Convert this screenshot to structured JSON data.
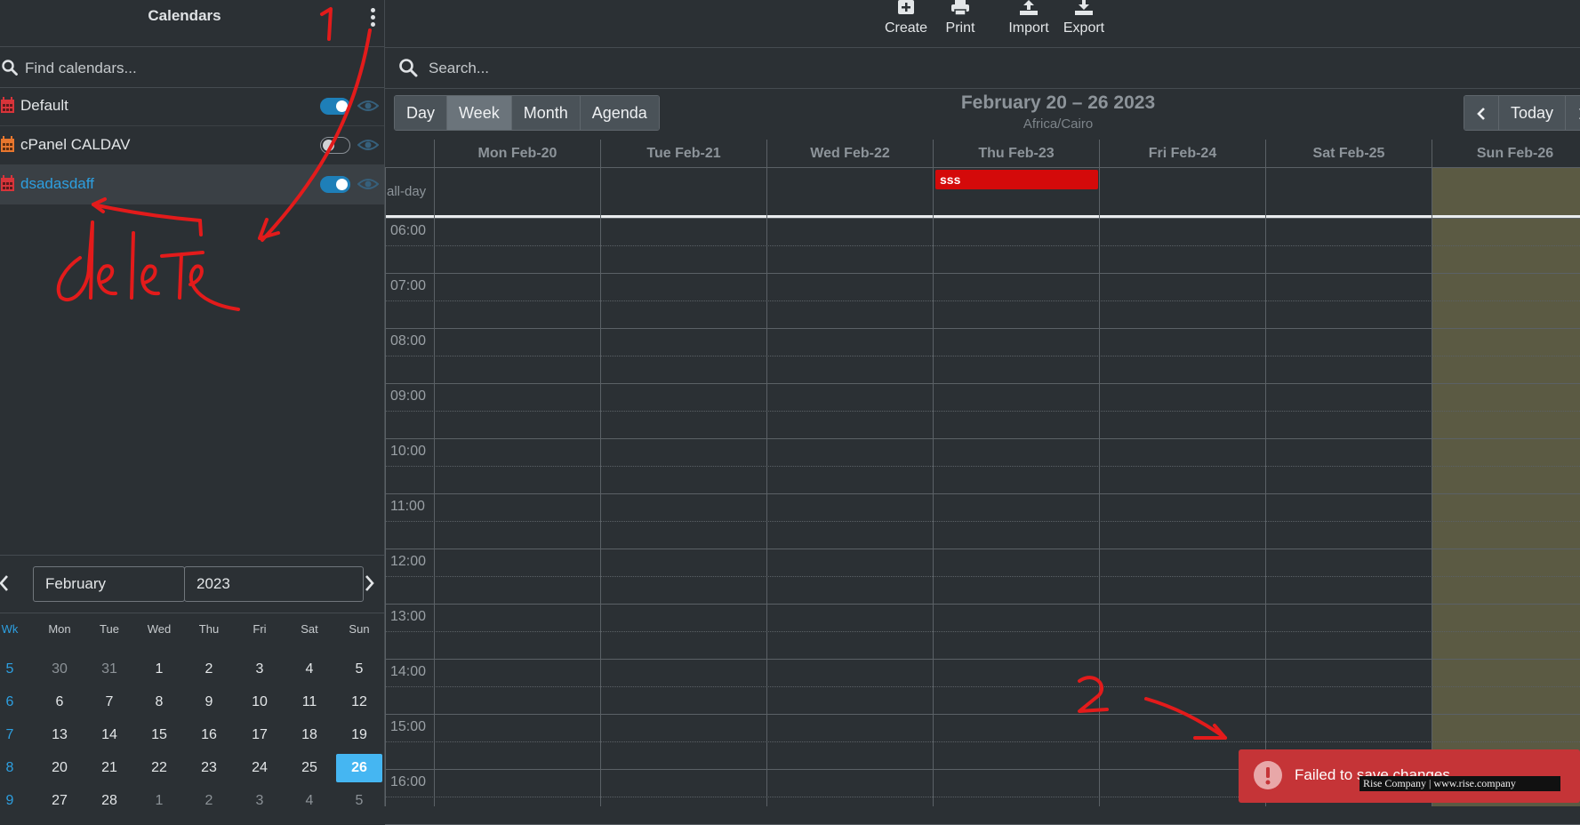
{
  "sidebar": {
    "title": "Calendars",
    "search_placeholder": "Find calendars...",
    "calendars": [
      {
        "name": "Default",
        "enabled": true,
        "icon": "calendar-icon",
        "color": "#d8343a"
      },
      {
        "name": "cPanel CALDAV",
        "enabled": false,
        "icon": "calendar-icon",
        "color": "#e8772e"
      },
      {
        "name": "dsadasdaff",
        "enabled": true,
        "icon": "calendar-icon",
        "color": "#d8343a",
        "selected": true
      }
    ]
  },
  "mini_calendar": {
    "month": "February",
    "year": "2023",
    "headers": [
      "Wk",
      "Mon",
      "Tue",
      "Wed",
      "Thu",
      "Fri",
      "Sat",
      "Sun"
    ],
    "weeks": [
      {
        "wk": "5",
        "days": [
          "30",
          "31",
          "1",
          "2",
          "3",
          "4",
          "5"
        ]
      },
      {
        "wk": "6",
        "days": [
          "6",
          "7",
          "8",
          "9",
          "10",
          "11",
          "12"
        ]
      },
      {
        "wk": "7",
        "days": [
          "13",
          "14",
          "15",
          "16",
          "17",
          "18",
          "19"
        ]
      },
      {
        "wk": "8",
        "days": [
          "20",
          "21",
          "22",
          "23",
          "24",
          "25",
          "26"
        ]
      },
      {
        "wk": "9",
        "days": [
          "27",
          "28",
          "1",
          "2",
          "3",
          "4",
          "5"
        ]
      }
    ],
    "today": "26"
  },
  "toolbar": {
    "create_label": "Create",
    "print_label": "Print",
    "import_label": "Import",
    "export_label": "Export"
  },
  "search": {
    "placeholder": "Search..."
  },
  "views": {
    "day": "Day",
    "week": "Week",
    "month": "Month",
    "agenda": "Agenda",
    "active": "week"
  },
  "navigation": {
    "today_label": "Today"
  },
  "range": {
    "title": "February 20 – 26 2023",
    "timezone": "Africa/Cairo"
  },
  "week": {
    "days": [
      "Mon Feb-20",
      "Tue Feb-21",
      "Wed Feb-22",
      "Thu Feb-23",
      "Fri Feb-24",
      "Sat Feb-25",
      "Sun Feb-26"
    ],
    "allday_label": "all-day",
    "times": [
      "06:00",
      "07:00",
      "08:00",
      "09:00",
      "10:00",
      "11:00",
      "12:00",
      "13:00",
      "14:00",
      "15:00",
      "16:00"
    ],
    "events": [
      {
        "title": "sss",
        "day": "Thu Feb-23",
        "allday": true,
        "color": "#d40a0a"
      }
    ],
    "today_highlight_color": "#5b5a43"
  },
  "toast": {
    "message": "Failed to save changes",
    "type": "error"
  },
  "watermark": "Rise Company | www.rise.company",
  "annotations": {
    "label_1": "1",
    "label_delete": "delete",
    "label_2": "2",
    "color": "#e31b1b"
  }
}
